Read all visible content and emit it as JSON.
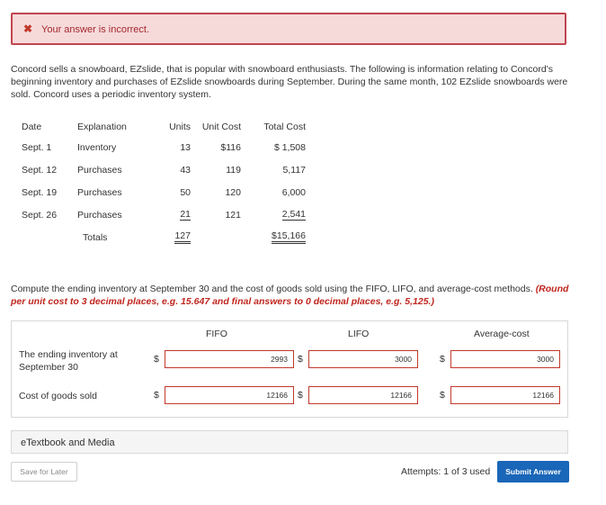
{
  "alert": {
    "icon": "x-icon",
    "message": "Your answer is incorrect."
  },
  "problem": {
    "text": "Concord sells a snowboard, EZslide, that is popular with snowboard enthusiasts. The following is information relating to Concord's beginning inventory and purchases of EZslide snowboards during September. During the same month, 102 EZslide snowboards were sold. Concord uses a periodic inventory system."
  },
  "inventory_table": {
    "headers": [
      "Date",
      "Explanation",
      "Units",
      "Unit Cost",
      "Total Cost"
    ],
    "rows": [
      {
        "date": "Sept. 1",
        "explanation": "Inventory",
        "units": "13",
        "unit_cost": "$116",
        "total_cost": "$ 1,508"
      },
      {
        "date": "Sept. 12",
        "explanation": "Purchases",
        "units": "43",
        "unit_cost": "119",
        "total_cost": "5,117"
      },
      {
        "date": "Sept. 19",
        "explanation": "Purchases",
        "units": "50",
        "unit_cost": "120",
        "total_cost": "6,000"
      },
      {
        "date": "Sept. 26",
        "explanation": "Purchases",
        "units": "21",
        "unit_cost": "121",
        "total_cost": "2,541"
      }
    ],
    "totals": {
      "label": "Totals",
      "units": "127",
      "total_cost": "$15,166"
    }
  },
  "instructions": {
    "text": "Compute the ending inventory at September 30 and the cost of goods sold using the FIFO, LIFO, and average-cost methods.",
    "note": "(Round per unit cost to 3 decimal places, e.g. 15.647 and final answers to 0 decimal places, e.g. 5,125.)"
  },
  "answers": {
    "columns": [
      "FIFO",
      "LIFO",
      "Average-cost"
    ],
    "currency": "$",
    "rows": [
      {
        "label": "The ending inventory at September 30",
        "fifo": "2993",
        "lifo": "3000",
        "average": "3000"
      },
      {
        "label": "Cost of goods sold",
        "fifo": "12166",
        "lifo": "12166",
        "average": "12166"
      }
    ]
  },
  "etextbook": {
    "label": "eTextbook and Media"
  },
  "footer": {
    "save_label": "Save for Later",
    "attempts": "Attempts: 1 of 3 used",
    "submit_label": "Submit Answer"
  },
  "colors": {
    "error_bg": "#f6dada",
    "error_border": "#c0454f",
    "note_red": "#c0261e",
    "submit_blue": "#1a66b8"
  }
}
